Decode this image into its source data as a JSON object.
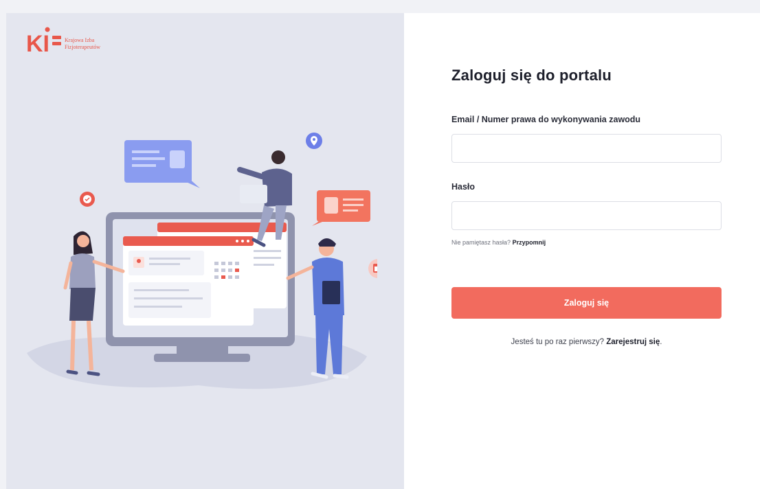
{
  "brand": {
    "logo_letters": "KI",
    "name_line1": "Krajowa Izba",
    "name_line2": "Fizjoterapeutów",
    "accent": "#e8574a"
  },
  "login": {
    "title": "Zaloguj się do portalu",
    "email_label": "Email / Numer prawa do wykonywania zawodu",
    "email_value": "",
    "password_label": "Hasło",
    "password_value": "",
    "forgot_text": "Nie pamiętasz hasła?",
    "forgot_link": "Przypomnij",
    "submit_label": "Zaloguj się",
    "register_text": "Jesteś tu po raz pierwszy?",
    "register_link": "Zarejestruj się",
    "button_color": "#f26b5e"
  },
  "illustration": {
    "icons": [
      "chat-bubble-icon",
      "location-pin-icon",
      "check-badge-icon",
      "calendar-icon"
    ]
  }
}
